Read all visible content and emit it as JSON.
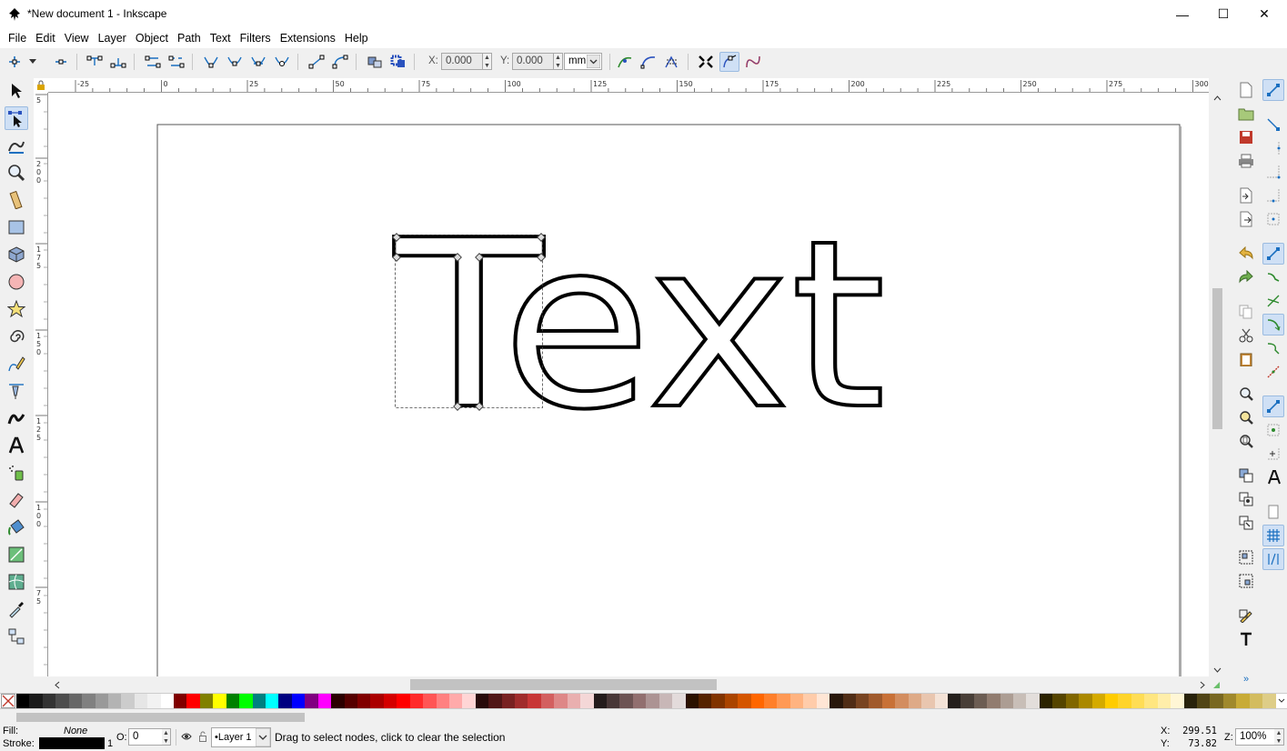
{
  "window": {
    "title": "*New document 1 - Inkscape",
    "minimize": "—",
    "maximize": "☐",
    "close": "✕"
  },
  "menu": [
    "File",
    "Edit",
    "View",
    "Layer",
    "Object",
    "Path",
    "Text",
    "Filters",
    "Extensions",
    "Help"
  ],
  "toolbar": {
    "x_label": "X:",
    "x_value": "0.000",
    "y_label": "Y:",
    "y_value": "0.000",
    "unit": "mm"
  },
  "ruler": {
    "h_ticks": [
      "-25",
      "0",
      "25",
      "50",
      "75",
      "100",
      "125",
      "150",
      "175",
      "200",
      "225",
      "250",
      "275",
      "300"
    ],
    "v_ticks": [
      "5",
      "2\n0\n0",
      "1\n7\n5",
      "1\n5\n0",
      "1\n2\n5",
      "1\n0\n0",
      "7\n5"
    ]
  },
  "canvas": {
    "text": "Text"
  },
  "palette": {
    "colors": [
      "#000000",
      "#1a1a1a",
      "#333333",
      "#4d4d4d",
      "#666666",
      "#808080",
      "#999999",
      "#b3b3b3",
      "#cccccc",
      "#e6e6e6",
      "#f2f2f2",
      "#ffffff",
      "#800000",
      "#ff0000",
      "#808000",
      "#ffff00",
      "#008000",
      "#00ff00",
      "#008080",
      "#00ffff",
      "#000080",
      "#0000ff",
      "#800080",
      "#ff00ff",
      "#2b0000",
      "#550000",
      "#800000",
      "#aa0000",
      "#d40000",
      "#ff0000",
      "#ff2a2a",
      "#ff5555",
      "#ff8080",
      "#ffaaaa",
      "#ffd5d5",
      "#280b0b",
      "#501616",
      "#782121",
      "#a02c2c",
      "#c83737",
      "#d35f5f",
      "#de8787",
      "#e9afaf",
      "#f4d7d7",
      "#241c1c",
      "#483737",
      "#6c5353",
      "#916f6f",
      "#ac9393",
      "#c8b7b7",
      "#e3dbdb",
      "#2b1100",
      "#552200",
      "#803300",
      "#aa4400",
      "#d45500",
      "#ff6600",
      "#ff7f2a",
      "#ff9955",
      "#ffb380",
      "#ffccaa",
      "#ffe6d5",
      "#28170b",
      "#502d16",
      "#784421",
      "#a05a2c",
      "#c87137",
      "#d38d5f",
      "#deaa87",
      "#e9c6af",
      "#f4e3d7",
      "#241f1c",
      "#483e37",
      "#6c5d53",
      "#917c6f",
      "#ac9d93",
      "#c8beb7",
      "#e3dedb",
      "#2b2200",
      "#554400",
      "#806600",
      "#aa8800",
      "#d4aa00",
      "#ffcc00",
      "#ffd42a",
      "#ffdd55",
      "#ffe680",
      "#ffeeaa",
      "#fff6d5",
      "#28220b",
      "#504416",
      "#786721",
      "#a0892c",
      "#c8ab37",
      "#d3bc5f",
      "#decd87"
    ]
  },
  "status": {
    "fill_label": "Fill:",
    "fill_value": "None",
    "stroke_label": "Stroke:",
    "stroke_width": "1",
    "opacity_label": "O:",
    "opacity_value": "0",
    "layer": "•Layer 1",
    "message": "Drag to select nodes, click to clear the selection",
    "x_label": "X:",
    "x_value": "299.51",
    "y_label": "Y:",
    "y_value": "73.82",
    "zoom_label": "Z:",
    "zoom_value": "100%"
  },
  "colors": {
    "active_bg": "#cfe0f5",
    "active_border": "#9bbbe0",
    "icon_blue": "#1a6fc0",
    "icon_green": "#2d8a2d"
  }
}
